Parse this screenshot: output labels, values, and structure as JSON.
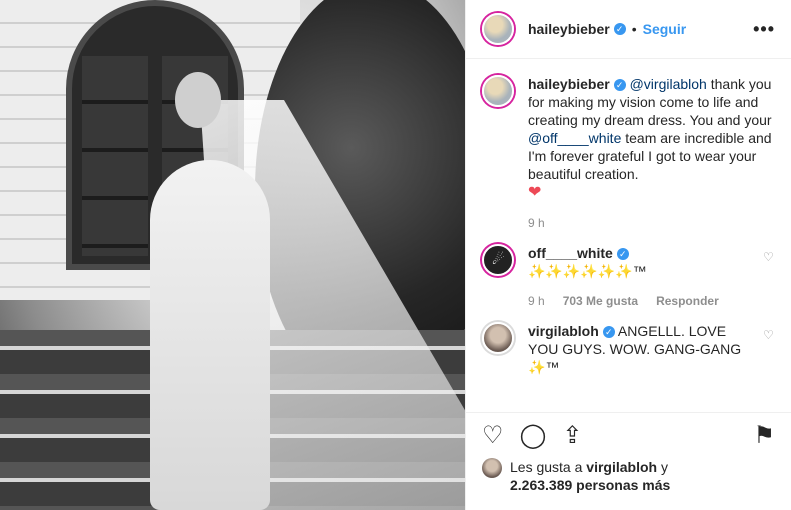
{
  "post": {
    "author": "haileybieber",
    "follow_label": "Seguir",
    "more_label": "•••"
  },
  "caption": {
    "user": "haileybieber",
    "mention1": "@virgilabloh",
    "text1": " thank you for making my vision come to life and creating my dream dress. You and your ",
    "mention2": "@off____white",
    "text2": " team are incredible and I'm forever grateful I got to wear your beautiful creation.",
    "emoji": "❤",
    "time": "9 h"
  },
  "comments": [
    {
      "user": "off____white",
      "text": "✨✨✨✨✨✨™",
      "time": "9 h",
      "likes": "703 Me gusta",
      "reply": "Responder"
    },
    {
      "user": "virgilabloh",
      "text": "ANGELLL. LOVE YOU GUYS. WOW. GANG-GANG ✨™"
    }
  ],
  "likes": {
    "prefix": "Les gusta a ",
    "user": "virgilabloh",
    "middle": " y",
    "count": "2.263.389 personas más"
  },
  "icons": {
    "like": "heart-icon",
    "comment": "comment-icon",
    "share": "share-icon",
    "save": "bookmark-icon"
  },
  "colors": {
    "accent": "#3897f0",
    "mention": "#003569",
    "heart": "#ed4956"
  }
}
